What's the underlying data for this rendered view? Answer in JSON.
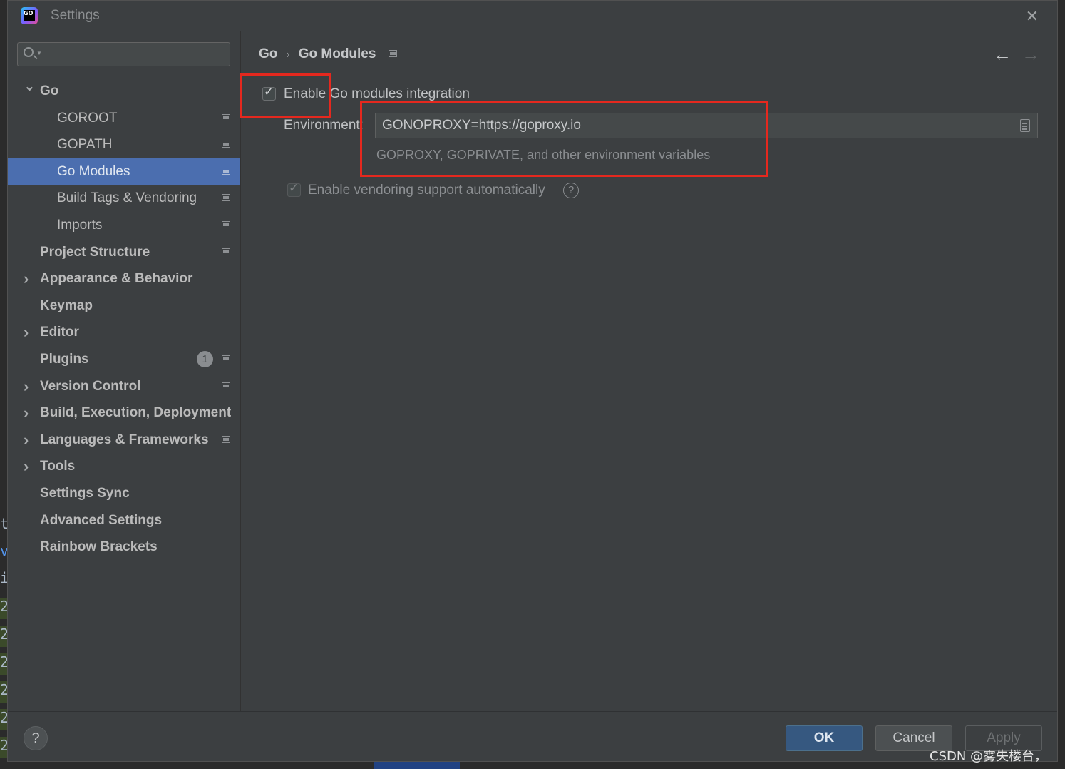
{
  "window": {
    "title": "Settings",
    "close_glyph": "✕",
    "logo_text": "GO"
  },
  "search": {
    "placeholder": "",
    "value": ""
  },
  "sidebar": {
    "items": [
      {
        "label": "Go",
        "expanded": true,
        "bold": true
      },
      {
        "label": "GOROOT",
        "project_icon": true
      },
      {
        "label": "GOPATH",
        "project_icon": true
      },
      {
        "label": "Go Modules",
        "selected": true,
        "project_icon": true
      },
      {
        "label": "Build Tags & Vendoring",
        "project_icon": true
      },
      {
        "label": "Imports",
        "project_icon": true
      },
      {
        "label": "Project Structure",
        "bold": true,
        "project_icon": true
      },
      {
        "label": "Appearance & Behavior",
        "bold": true,
        "expandable": true
      },
      {
        "label": "Keymap",
        "bold": true
      },
      {
        "label": "Editor",
        "bold": true,
        "expandable": true
      },
      {
        "label": "Plugins",
        "bold": true,
        "badge": "1",
        "project_icon": true
      },
      {
        "label": "Version Control",
        "bold": true,
        "expandable": true,
        "project_icon": true
      },
      {
        "label": "Build, Execution, Deployment",
        "bold": true,
        "expandable": true
      },
      {
        "label": "Languages & Frameworks",
        "bold": true,
        "expandable": true,
        "project_icon": true
      },
      {
        "label": "Tools",
        "bold": true,
        "expandable": true
      },
      {
        "label": "Settings Sync",
        "bold": true
      },
      {
        "label": "Advanced Settings",
        "bold": true
      },
      {
        "label": "Rainbow Brackets",
        "bold": true
      }
    ]
  },
  "breadcrumb": {
    "parent": "Go",
    "separator": "›",
    "current": "Go Modules"
  },
  "nav": {
    "back": "←",
    "forward": "→"
  },
  "form": {
    "enable_modules": {
      "label": "Enable Go modules integration",
      "checked": true
    },
    "environment": {
      "label": "Environment:",
      "value": "GONOPROXY=https://goproxy.io",
      "hint": "GOPROXY, GOPRIVATE, and other environment variables"
    },
    "vendoring": {
      "label": "Enable vendoring support automatically",
      "checked": true,
      "enabled": false
    }
  },
  "footer": {
    "help": "?",
    "ok": "OK",
    "cancel": "Cancel",
    "apply": "Apply"
  },
  "watermark": "CSDN @雾失楼台，",
  "background_editor": {
    "lines": [
      "t",
      "v",
      "i",
      "2",
      "2",
      "2",
      "2",
      "2",
      "2"
    ]
  },
  "colors": {
    "dialog_bg": "#3c3f41",
    "selection": "#4b6eaf",
    "ok_button": "#365880",
    "annotation_red": "#e5281e"
  }
}
